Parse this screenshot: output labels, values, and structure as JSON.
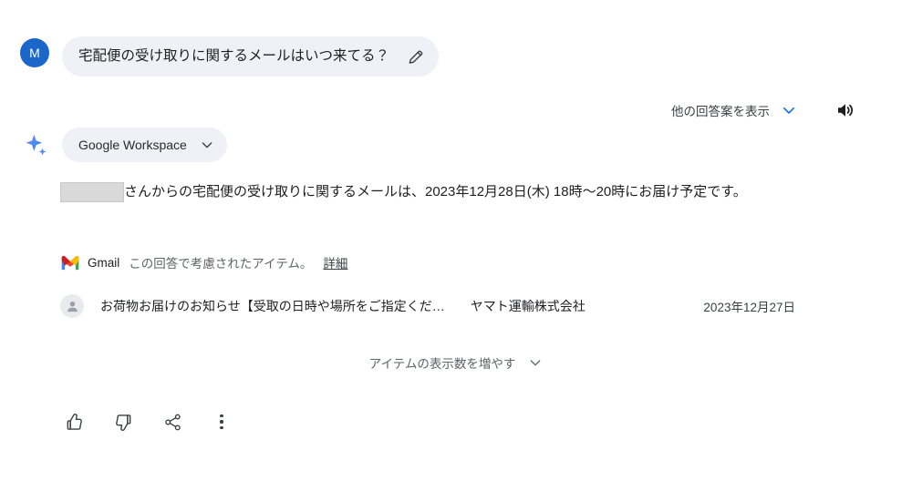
{
  "prompt": {
    "avatar_initial": "M",
    "text": "宅配便の受け取りに関するメールはいつ来てる？",
    "edit_icon": "pencil-icon"
  },
  "drafts": {
    "label": "他の回答案を表示",
    "chevron_icon": "chevron-down-icon",
    "speaker_icon": "speaker-icon",
    "accent_color": "#1a73e8"
  },
  "source": {
    "sparkle_icon": "sparkle-icon",
    "chip_label": "Google Workspace",
    "chip_chevron_icon": "chevron-down-icon"
  },
  "answer": {
    "redacted_placeholder": "",
    "text": "さんからの宅配便の受け取りに関するメールは、2023年12月28日(木) 18時～20時にお届け予定です。"
  },
  "citation": {
    "app_icon": "gmail-icon",
    "app_name": "Gmail",
    "note": "この回答で考慮されたアイテム。",
    "details_label": "詳細"
  },
  "items": [
    {
      "avatar_icon": "person-icon",
      "subject": "お荷物お届けのお知らせ【受取の日時や場所をご指定くだ…",
      "sender": "ヤマト運輸株式会社",
      "date": "2023年12月27日"
    }
  ],
  "show_more": {
    "label": "アイテムの表示数を増やす",
    "chevron_icon": "chevron-down-icon"
  },
  "actions": [
    {
      "name": "thumb-up-button",
      "icon": "thumb-up-icon"
    },
    {
      "name": "thumb-down-button",
      "icon": "thumb-down-icon"
    },
    {
      "name": "share-button",
      "icon": "share-icon"
    },
    {
      "name": "more-options-button",
      "icon": "more-vert-icon"
    }
  ]
}
